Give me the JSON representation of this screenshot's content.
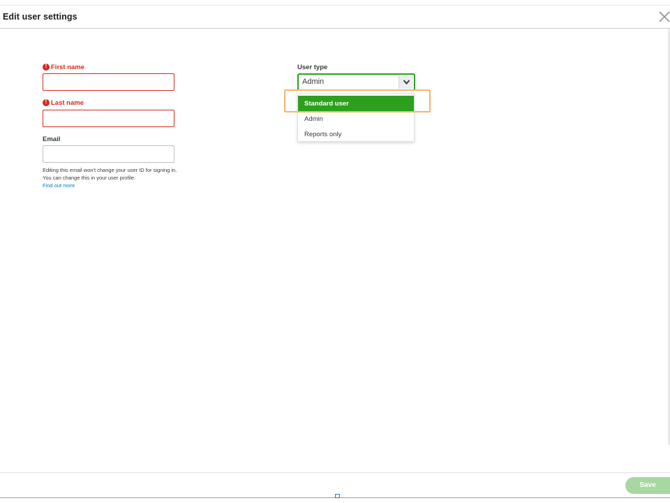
{
  "dialog": {
    "title": "Edit user settings"
  },
  "form": {
    "first_name": {
      "label": "First name",
      "value": "",
      "state": "error"
    },
    "last_name": {
      "label": "Last name",
      "value": "",
      "state": "error"
    },
    "email": {
      "label": "Email",
      "value": "",
      "helper_text": "Editing this email won't change your user ID for signing in. You can change this in your user profile.",
      "link_text": "Find out more"
    },
    "user_type": {
      "label": "User type",
      "selected_value": "Admin",
      "options": [
        "Standard user",
        "Admin",
        "Reports only"
      ],
      "highlighted_option": "Standard user"
    }
  },
  "footer": {
    "save_label": "Save"
  },
  "colors": {
    "accent_green": "#2ca01c",
    "error_red": "#d52b1e",
    "link_blue": "#0077c5",
    "highlight_orange": "#f4b66a",
    "save_disabled": "#a8d8a2"
  },
  "icons": {
    "close": "close-icon",
    "error": "error-icon",
    "dropdown": "chevron-down-icon"
  }
}
